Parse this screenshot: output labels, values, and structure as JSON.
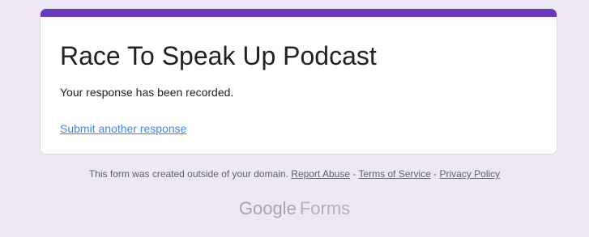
{
  "form": {
    "title": "Race To Speak Up Podcast",
    "confirmation": "Your response has been recorded.",
    "submit_another_label": "Submit another response",
    "accent_color": "#673ab7"
  },
  "footer": {
    "notice": "This form was created outside of your domain.",
    "report_abuse": "Report Abuse",
    "separator": " - ",
    "terms": "Terms of Service",
    "privacy": "Privacy Policy"
  },
  "brand": {
    "google": "Google",
    "forms": "Forms"
  },
  "colors": {
    "background": "#ede7f6",
    "link": "#4285f4"
  }
}
